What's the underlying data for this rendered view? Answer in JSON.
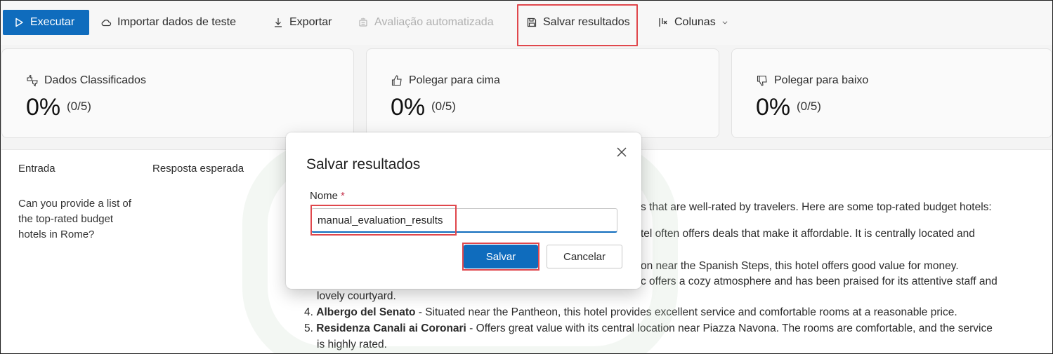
{
  "toolbar": {
    "run_label": "Executar",
    "import_label": "Importar dados de teste",
    "export_label": "Exportar",
    "auto_eval_label": "Avaliação automatizada",
    "save_results_label": "Salvar resultados",
    "columns_label": "Colunas",
    "icons": [
      "play-icon",
      "cloud-icon",
      "download-icon",
      "evaluate-icon",
      "save-icon",
      "columns-icon",
      "chevron-down-icon"
    ]
  },
  "cards": [
    {
      "label": "Dados Classificados",
      "percent": "0%",
      "fraction": "(0/5)",
      "icon": "thumbs-up-down-icon"
    },
    {
      "label": "Polegar para cima",
      "percent": "0%",
      "fraction": "(0/5)",
      "icon": "thumbs-up-icon"
    },
    {
      "label": "Polegar para baixo",
      "percent": "0%",
      "fraction": "(0/5)",
      "icon": "thumbs-down-icon"
    }
  ],
  "table": {
    "headers": [
      "Entrada",
      "Resposta esperada"
    ],
    "input_text": "Can you provide a list of the top-rated budget hotels in Rome?",
    "response_fragments": [
      "s that are well-rated by travelers. Here are some top-rated budget hotels:",
      "tel often offers deals that make it affordable. It is centrally located and",
      "on near the Spanish Steps, this hotel offers good value for money.",
      "c offers a cozy atmosphere and has been praised for its attentive staff and",
      "lovely courtyard."
    ],
    "item4_num": "4.",
    "item4_name": "Albergo del Senato",
    "item4_text": " - Situated near the Pantheon, this hotel provides excellent service and comfortable rooms at a reasonable price.",
    "item5_num": "5.",
    "item5_name": "Residenza Canali ai Coronari",
    "item5_text": " - Offers great value with its central location near Piazza Navona. The rooms are comfortable, and the service",
    "item5_cont": "is highly rated."
  },
  "dialog": {
    "title": "Salvar resultados",
    "name_label": "Nome",
    "required_mark": "*",
    "name_value": "manual_evaluation_results",
    "save_label": "Salvar",
    "cancel_label": "Cancelar"
  },
  "colors": {
    "accent": "#0f6cbd",
    "highlight": "#e0474c"
  }
}
